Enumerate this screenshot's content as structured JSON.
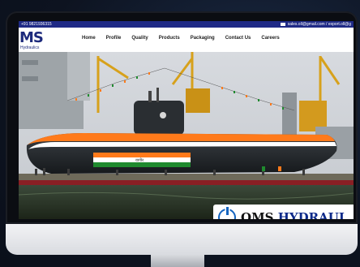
{
  "topbar": {
    "phone": "+91 9821936315",
    "email": "sales.oll@gmail.com / export.oll@g"
  },
  "logo": {
    "mark": "MS",
    "sub": "Hydraulics"
  },
  "nav": {
    "items": [
      "Home",
      "Profile",
      "Quality",
      "Products",
      "Packaging",
      "Contact Us",
      "Careers"
    ]
  },
  "hero": {
    "image_subject": "submarine-in-dock",
    "flag_colors": [
      "#ff7a1a",
      "#ffffff",
      "#1f8a2e"
    ]
  },
  "badge": {
    "first": "OMS",
    "second": "HYDRAUL"
  },
  "icons": [
    "mail-icon",
    "power-icon"
  ]
}
